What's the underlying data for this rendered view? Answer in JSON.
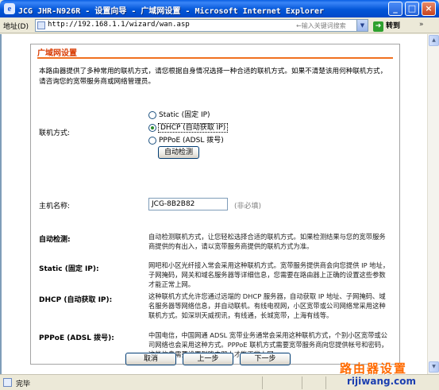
{
  "window": {
    "title": "JCG JHR-N926R - 设置向导 - 广域网设置 - Microsoft Internet Explorer",
    "minimize": "_",
    "maximize": "□",
    "close": "×"
  },
  "address_bar": {
    "label": "地址(D)",
    "url": "http://192.168.1.1/wizard/wan.asp",
    "search_hint": "←输入关键词搜索",
    "go_label": "转到",
    "links_chevron": "»"
  },
  "page": {
    "section_title": "广域网设置",
    "intro": "本路由器提供了多种常用的联机方式，请您根据自身情况选择一种合适的联机方式。如果不清楚该用何种联机方式，请咨询您的宽带服务商或网络管理员。",
    "connection_label": "联机方式:",
    "options": [
      {
        "label": "Static (固定 IP)",
        "selected": false
      },
      {
        "label": "DHCP (自动获取 IP)",
        "selected": true
      },
      {
        "label": "PPPoE (ADSL 拨号)",
        "selected": false
      }
    ],
    "auto_detect_button": "自动检测",
    "hostname_label": "主机名称:",
    "hostname_value": "JCG-8B2B82",
    "hostname_note": "(非必填)",
    "help": [
      {
        "label": "自动检测:",
        "text": "自动检测联机方式，让您轻松选择合适的联机方式。如果检测结果与您的宽带服务商提供的有出入，请以宽带服务商提供的联机方式为准。"
      },
      {
        "label": "Static (固定 IP):",
        "text": "网吧和小区光纤接入常会采用这种联机方式。宽带服务提供商会向您提供 IP 地址，子网掩码，网关和域名服务器等详细信息，您需要在路由器上正确的设置这些参数才能正常上网。"
      },
      {
        "label": "DHCP (自动获取 IP):",
        "text": "这种联机方式允许您通过远端的 DHCP 服务器，自动获取 IP 地址、子网掩码、域名服务器等网络信息，并自动联机。有线电视网，小区宽带或公司网络常采用这种联机方式。如深圳天威视讯，有线通，长城宽带，上海有线等。"
      },
      {
        "label": "PPPoE (ADSL 拨号):",
        "text": "中国电信，中国网通 ADSL 宽带业务通常会采用这种联机方式，个别小区宽带或公司网络也会采用这种方式。PPPoE 联机方式需要宽带服务商向您提供帐号和密码，这些信息需要设置到路由器上才能正常上网。"
      }
    ],
    "buttons": {
      "cancel": "取消",
      "prev": "上一步",
      "next": "下一步"
    }
  },
  "status_bar": {
    "text": "完毕"
  },
  "watermark": {
    "line1": "路由器设置",
    "line2": "rijiwang.com"
  }
}
